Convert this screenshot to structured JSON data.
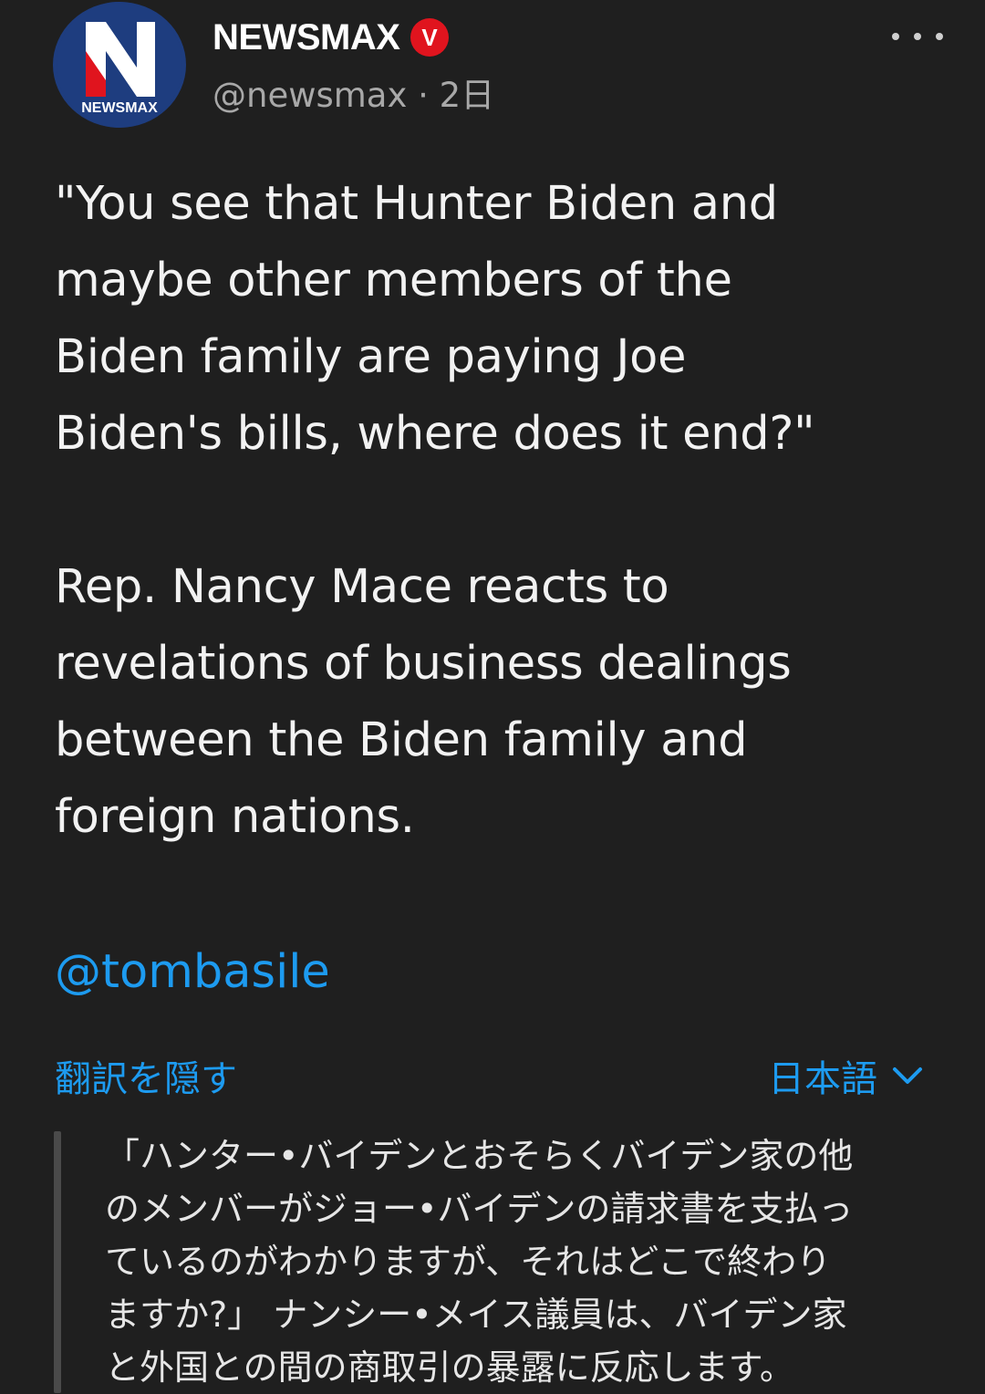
{
  "header": {
    "display_name": "NEWSMAX",
    "verified_badge_letter": "V",
    "handle": "@newsmax",
    "separator": "·",
    "time_ago": "2日",
    "avatar_logo_text": "NEWSMAX",
    "avatar_letter": "N",
    "more_icon": "more-horizontal-icon"
  },
  "tweet": {
    "paragraph_1": [
      "\"You see that Hunter Biden and",
      "maybe other members of the",
      "Biden family are paying Joe",
      "Biden's bills, where does it end?\""
    ],
    "paragraph_2": [
      "Rep. Nancy Mace reacts to",
      "revelations of business dealings",
      "between the Biden family and",
      "foreign nations."
    ],
    "mention": "@tombasile"
  },
  "translation": {
    "hide_label": "翻訳を隠す",
    "language": "日本語",
    "language_icon": "chevron-down-icon",
    "lines": [
      "「ハンター•バイデンとおそらくバイデン家の他",
      "のメンバーがジョー•バイデンの請求書を支払っ",
      "ているのがわかりますが、それはどこで終わり",
      "ますか?」 ナンシー•メイス議員は、バイデン家",
      "と外国との間の商取引の暴露に反応します。"
    ]
  },
  "colors": {
    "background": "#1f1f1f",
    "link": "#1d9bf0",
    "badge": "#e0141e",
    "avatar_blue": "#1e3d7f"
  }
}
